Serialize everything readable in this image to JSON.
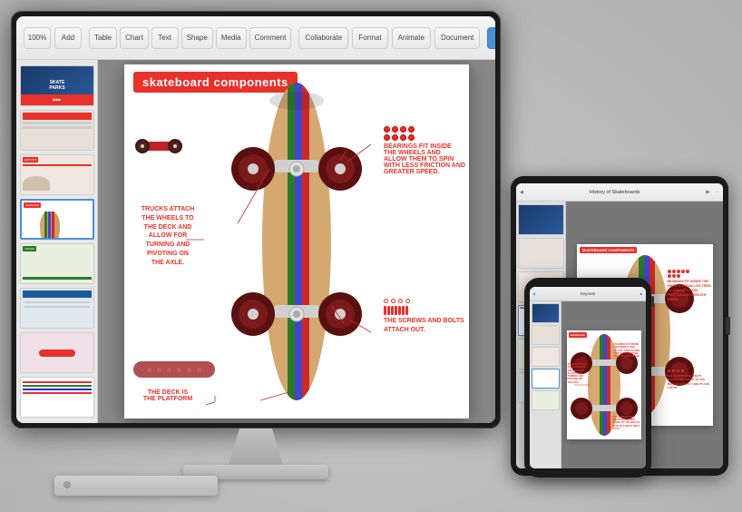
{
  "app": {
    "title": "Keynote",
    "subtitle": "History of Skateboards"
  },
  "toolbar": {
    "zoom": "100%",
    "add_btn": "Add",
    "table_btn": "Table",
    "chart_btn": "Chart",
    "text_btn": "Text",
    "shape_btn": "Shape",
    "media_btn": "Media",
    "comment_btn": "Comment",
    "format_btn": "Format",
    "animate_btn": "Animate",
    "document_btn": "Document",
    "play_btn": "▶",
    "collaborate_btn": "Collaborate"
  },
  "slide": {
    "title": "skateboard components",
    "annotations": {
      "trucks": "TRUCKS ATTACH\nTHE WHEELS TO\nTHE DECK AND\nALLOW FOR\nTURNING AND\nPIVOTING ON\nTHE AXLE.",
      "deck": "THE DECK IS\nTHE PLATFORM",
      "bearings_label": "INSIDE THE",
      "bearings": "BEARINGS FIT\nINSIDE THE\nWHEELS AND\nALLOW THEM\nTO SPIN WITH\nLESS FRICTION\nAND GREATER\nSPEED.",
      "screws": "THE SCREWS AND\nBOLTS ATTACH\nOUT."
    }
  },
  "tablet": {
    "toolbar_title": "History of Skateboards"
  },
  "phone": {
    "toolbar_title": "Keynote"
  }
}
